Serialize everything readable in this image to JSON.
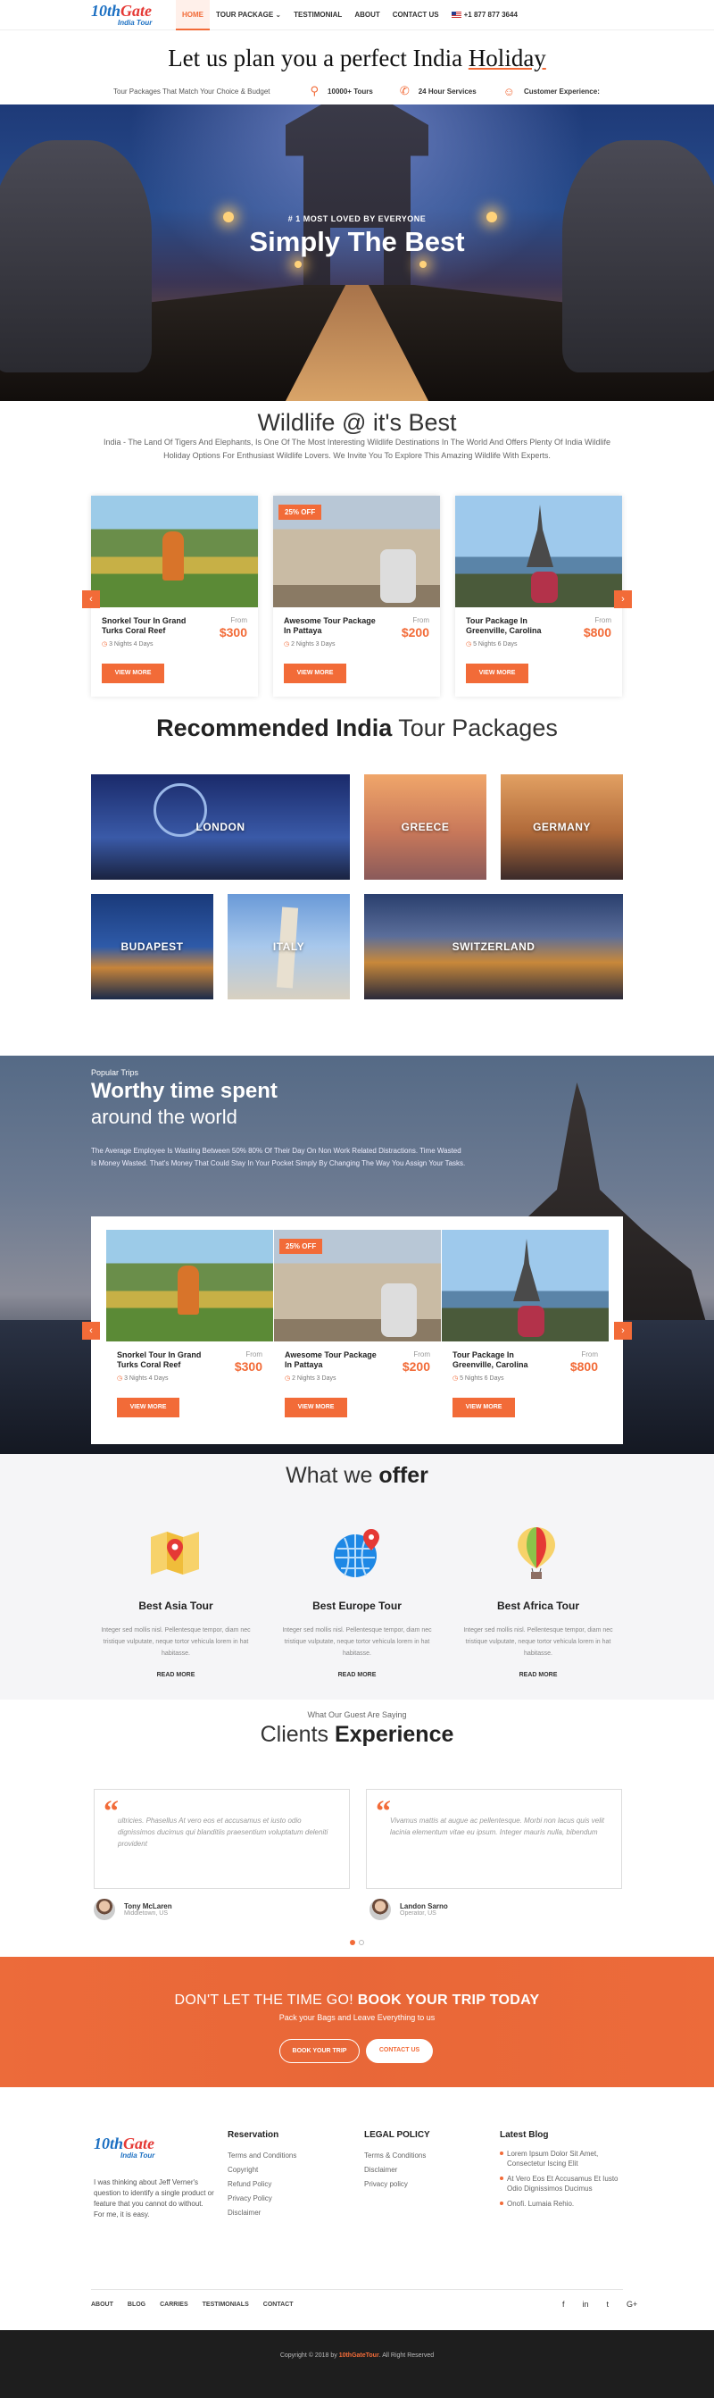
{
  "header": {
    "logo": {
      "ten": "10th",
      "gate": "Gate",
      "sub": "India Tour"
    },
    "nav": [
      "HOME",
      "TOUR PACKAGE",
      "TESTIMONIAL",
      "ABOUT",
      "CONTACT US"
    ],
    "nav_caret": "⌄",
    "phone": "+1 877 877 3644"
  },
  "headline": {
    "prefix": "Let us plan you a perfect India ",
    "underlined": "Holiday"
  },
  "subhead": {
    "tagline": "Tour Packages That Match Your Choice & Budget",
    "tours": "10000+ Tours",
    "support": "24 Hour Services",
    "experience": "Customer Experience:"
  },
  "hero": {
    "eyebrow": "# 1 MOST LOVED BY EVERYONE",
    "title": "Simply The Best"
  },
  "wildlife": {
    "title": "Wildlife @ it's Best",
    "text": "India - The Land Of Tigers And Elephants, Is One Of The Most Interesting Wildlife Destinations In The World And Offers Plenty Of India Wildlife Holiday Options For Enthusiast Wildlife Lovers. We Invite You To Explore This Amazing Wildlife With Experts."
  },
  "tours": [
    {
      "name": "Snorkel Tour In Grand Turks Coral Reef",
      "from": "From",
      "price": "$300",
      "duration": "3 Nights 4 Days",
      "badge": "",
      "button": "VIEW MORE"
    },
    {
      "name": "Awesome Tour Package In Pattaya",
      "from": "From",
      "price": "$200",
      "duration": "2 Nights 3 Days",
      "badge": "25% OFF",
      "button": "VIEW MORE"
    },
    {
      "name": "Tour Package In Greenville, Carolina",
      "from": "From",
      "price": "$800",
      "duration": "5 Nights 6 Days",
      "badge": "",
      "button": "VIEW MORE"
    }
  ],
  "arrows": {
    "prev": "‹",
    "next": "›"
  },
  "recommended": {
    "bold": "Recommended India",
    "rest": " Tour Packages"
  },
  "destinations": [
    "LONDON",
    "GREECE",
    "GERMANY",
    "BUDAPEST",
    "ITALY",
    "SWITZERLAND"
  ],
  "worthy": {
    "eyebrow": "Popular Trips",
    "title": "Worthy time spent",
    "subtitle": "around the world",
    "text": "The Average Employee Is Wasting Between 50% 80% Of Their Day On Non Work Related Distractions. Time Wasted Is Money Wasted. That's Money That Could Stay In Your Pocket Simply By Changing The Way You Assign Your Tasks."
  },
  "offer": {
    "title_pre": "What we ",
    "title_bold": "offer",
    "items": [
      {
        "title": "Best Asia Tour",
        "text": "Integer sed mollis nisl. Pellentesque tempor, diam nec tristique vulputate, neque tortor vehicula lorem in hat habitasse.",
        "link": "READ MORE",
        "icon": "map-icon"
      },
      {
        "title": "Best Europe Tour",
        "text": "Integer sed mollis nisl. Pellentesque tempor, diam nec tristique vulputate, neque tortor vehicula lorem in hat habitasse.",
        "link": "READ MORE",
        "icon": "globe-pin-icon"
      },
      {
        "title": "Best Africa Tour",
        "text": "Integer sed mollis nisl. Pellentesque tempor, diam nec tristique vulputate, neque tortor vehicula lorem in hat habitasse.",
        "link": "READ MORE",
        "icon": "balloon-icon"
      }
    ]
  },
  "clients": {
    "eyebrow": "What Our Guest Are Saying",
    "title_pre": "Clients ",
    "title_bold": "Experience",
    "quotes": [
      {
        "text": "ultricies. Phasellus At vero eos et accusamus et iusto odio dignissimos ducimus qui blanditiis praesentium voluptatum deleniti provident",
        "name": "Tony McLaren",
        "role": "Middletown, US"
      },
      {
        "text": "Vivamus mattis at augue ac pellentesque. Morbi non lacus quis velit lacinia elementum vitae eu ipsum. Integer mauris nulla, bibendum",
        "name": "Landon Sarno",
        "role": "Operator, US"
      }
    ]
  },
  "cta": {
    "pre": "DON'T LET THE TIME GO! ",
    "bold": "BOOK YOUR TRIP TODAY",
    "sub": "Pack your Bags and Leave Everything to us",
    "book": "BOOK YOUR TRIP",
    "contact": "CONTACT US"
  },
  "footer": {
    "about": "I was thinking about Jeff Verner's question to identify a single product or feature that you cannot do without. For me, it is easy.",
    "reservation": {
      "title": "Reservation",
      "links": [
        "Terms and Conditions",
        "Copyright",
        "Refund Policy",
        "Privacy Policy",
        "Disclaimer"
      ]
    },
    "legal": {
      "title": "LEGAL POLICY",
      "links": [
        "Terms & Conditions",
        "Disclaimer",
        "Privacy policy"
      ]
    },
    "blog": {
      "title": "Latest Blog",
      "posts": [
        "Lorem Ipsum Dolor Sit Amet, Consectetur Iscing Elit",
        "At Vero Eos Et Accusamus Et Iusto Odio Dignissimos Ducimus",
        "Onofi. Lumaia Rehio."
      ]
    },
    "nav": [
      "ABOUT",
      "BLOG",
      "CARRIES",
      "TESTIMONIALS",
      "CONTACT"
    ],
    "social": [
      "f",
      "in",
      "t",
      "G+"
    ],
    "copyright_pre": "Copyright © 2018 by ",
    "copyright_brand": "10thGateTour",
    "copyright_post": ". All Right Reserved"
  },
  "colors": {
    "accent": "#f26b38",
    "brand_blue": "#1b6fc2",
    "dark": "#1e1e1e"
  }
}
